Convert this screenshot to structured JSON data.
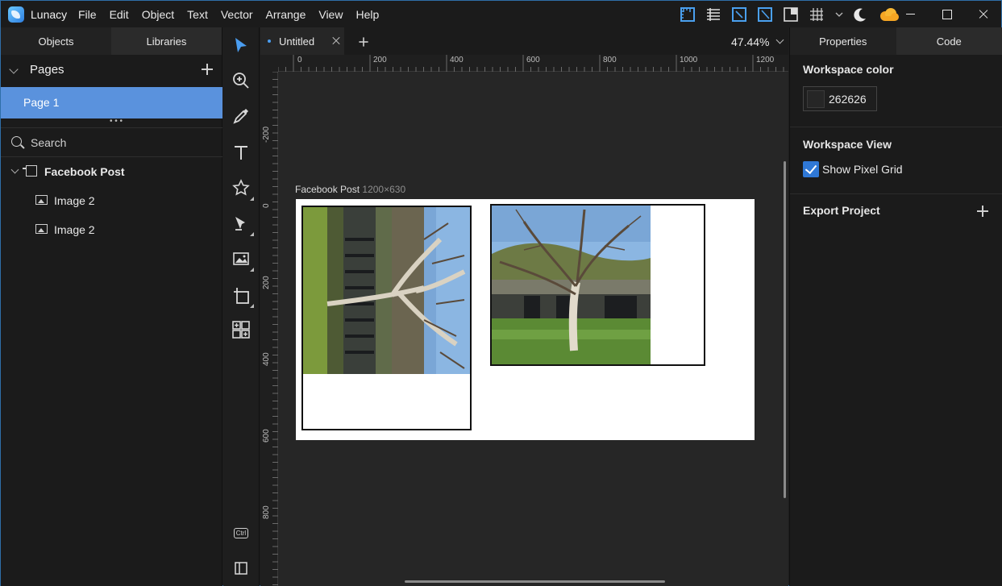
{
  "app": {
    "name": "Lunacy",
    "menu": [
      "File",
      "Edit",
      "Object",
      "Text",
      "Vector",
      "Arrange",
      "View",
      "Help"
    ]
  },
  "titlebar_icons": [
    "ruler-icon",
    "table-icon",
    "snap-icon",
    "snap-pixel-icon",
    "layout-grid-icon",
    "grid-icon",
    "chevron-down-icon",
    "moon-icon",
    "cloud-icon"
  ],
  "left_panel": {
    "tabs": [
      "Objects",
      "Libraries"
    ],
    "pages_title": "Pages",
    "pages": [
      "Page 1"
    ],
    "search_placeholder": "Search",
    "layers": [
      {
        "name": "Facebook Post",
        "type": "artboard"
      },
      {
        "name": "Image 2",
        "type": "image"
      },
      {
        "name": "Image 2",
        "type": "image"
      }
    ]
  },
  "tools": [
    "select-tool",
    "zoom-tool",
    "eyedropper-tool",
    "text-tool",
    "shapes-tool",
    "pen-tool",
    "image-tool",
    "artboard-tool",
    "components-tool"
  ],
  "tools_bottom": {
    "ctrl_label": "Ctrl"
  },
  "canvas": {
    "doc_tab": "Untitled",
    "zoom": "47.44%",
    "ruler_h": [
      "0",
      "200",
      "400",
      "600",
      "800",
      "1000",
      "1200"
    ],
    "ruler_v": [
      "-200",
      "0",
      "200",
      "400",
      "600",
      "800"
    ],
    "artboard_name": "Facebook Post",
    "artboard_size": "1200×630",
    "workspace_color": "#262626"
  },
  "right_panel": {
    "tabs": [
      "Properties",
      "Code"
    ],
    "workspace_color_title": "Workspace color",
    "workspace_color_value": "262626",
    "workspace_view_title": "Workspace View",
    "show_pixel_grid_label": "Show Pixel Grid",
    "show_pixel_grid_checked": true,
    "export_title": "Export Project"
  },
  "colors": {
    "accent": "#4a9df0",
    "selection": "#5a92dd",
    "checkbox": "#2f78d6"
  }
}
